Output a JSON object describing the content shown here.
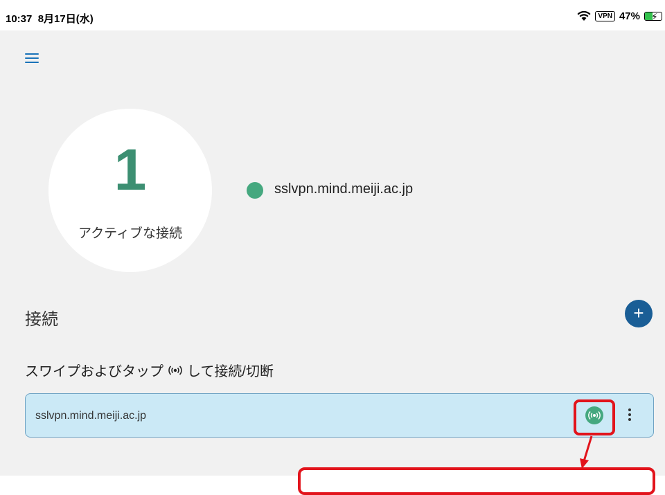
{
  "status_bar": {
    "time": "10:37",
    "date": "8月17日(水)",
    "vpn": "VPN",
    "battery_percent": "47%",
    "battery_level": 0.47
  },
  "summary": {
    "active_count": "1",
    "active_label": "アクティブな接続",
    "active_host": "sslvpn.mind.meiji.ac.jp"
  },
  "connections": {
    "section_title": "接続",
    "add_label": "+",
    "hint_before": "スワイプおよびタップ",
    "hint_after": "して接続/切断",
    "items": [
      {
        "name": "sslvpn.mind.meiji.ac.jp",
        "status": "connected"
      }
    ]
  },
  "colors": {
    "accent_green": "#45a87f",
    "accent_blue": "#1a5e96",
    "row_background": "#cbe9f6",
    "annotation_red": "#e2141c"
  },
  "icons": {
    "menu": "hamburger-menu-icon",
    "add": "plus-icon",
    "connect": "broadcast-icon",
    "more": "more-vertical-icon",
    "wifi": "wifi-icon",
    "battery": "battery-charging-icon"
  }
}
